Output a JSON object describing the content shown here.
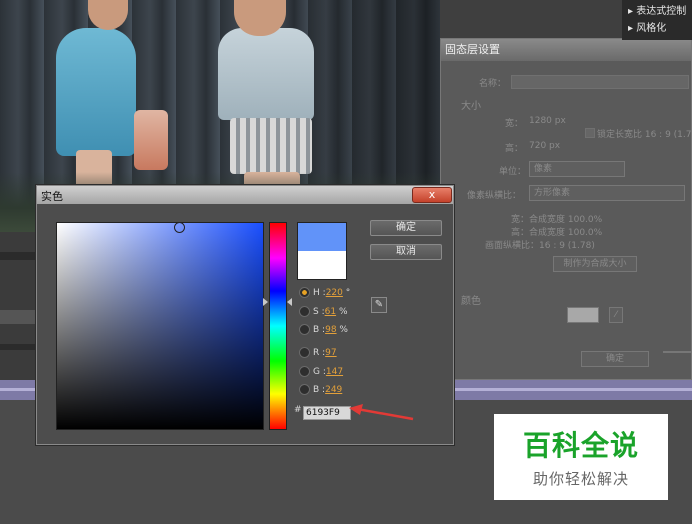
{
  "effects_panel": {
    "items": [
      "▸ 表达式控制",
      "▸ 风格化"
    ]
  },
  "layer_settings": {
    "title": "固态层设置",
    "name_label": "名称：",
    "size_header": "大小",
    "width_label": "宽：",
    "width_value": "1280 px",
    "height_label": "高：",
    "height_value": "720 px",
    "lock_label": "锁定长宽比 16 : 9 (1.78)",
    "unit_label": "单位：",
    "unit_value": "像素",
    "pixel_aspect_label": "像素纵横比：",
    "pixel_aspect_value": "方形像素",
    "info_width": "宽：合成宽度 100.0%",
    "info_height": "高：合成宽度 100.0%",
    "info_frame": "画面纵横比：16 : 9 (1.78)",
    "make_comp_size": "制作为合成大小",
    "color_header": "颜色",
    "ok": "确定"
  },
  "color_dialog": {
    "title": "实色",
    "close": "x",
    "ok": "确定",
    "cancel": "取消",
    "current_color": "#6193f9",
    "original_color": "#ffffff",
    "h_label": "H",
    "h_value": "220",
    "h_unit": "°",
    "s_label": "S",
    "s_value": "61",
    "s_unit": "%",
    "b_label": "B",
    "b_value": "98",
    "b_unit": "%",
    "r_label": "R",
    "r_value": "97",
    "g_label": "G",
    "g_value": "147",
    "bl_label": "B",
    "bl_value": "249",
    "hex_prefix": "#",
    "hex_value": "6193F9"
  },
  "watermark": {
    "title": "百科全说",
    "subtitle": "助你轻松解决"
  },
  "colors": {
    "accent_highlight": "#e3a03a",
    "close_button": "#c4422b",
    "red_arrow": "#e23a36",
    "watermark_green": "#1aa32a"
  }
}
